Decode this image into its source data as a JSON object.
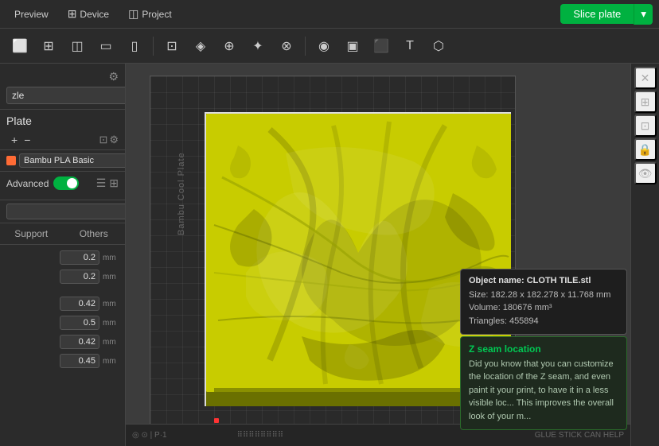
{
  "topbar": {
    "preview_label": "Preview",
    "device_label": "Device",
    "project_label": "Project",
    "slice_label": "Slice plate"
  },
  "toolbar": {
    "tools": [
      "⬜",
      "⊞",
      "◫",
      "▭",
      "▯",
      "⊡",
      "◈",
      "⊕",
      "✦",
      "⊗",
      "◉",
      "▣",
      "⬛",
      "T",
      "⬡"
    ]
  },
  "sidebar": {
    "nozzle_value": "zle",
    "plate_label": "Plate",
    "volumes_label": "",
    "filament_name": "Bambu PLA Basic",
    "advanced_label": "Advanced",
    "tab_support": "Support",
    "tab_others": "Others",
    "settings": [
      {
        "label": "",
        "value": "0.2",
        "unit": "mm"
      },
      {
        "label": "",
        "value": "0.2",
        "unit": "mm"
      },
      {
        "label": "",
        "value": "0.42",
        "unit": "mm"
      },
      {
        "label": "",
        "value": "0.5",
        "unit": "mm"
      },
      {
        "label": "",
        "value": "0.42",
        "unit": "mm"
      },
      {
        "label": "",
        "value": "0.45",
        "unit": "mm"
      }
    ]
  },
  "info_popup": {
    "title": "Object name: CLOTH TILE.stl",
    "line1": "Size: 182.28 x 182.278 x 11.768 mm",
    "line2": "Volume: 180676 mm³",
    "line3": "Triangles: 455894"
  },
  "zseam_popup": {
    "title": "Z seam location",
    "body": "Did you know that you can customize the location of the Z seam, and even paint it your print, to have it in a less visible loc... This improves the overall look of your m..."
  },
  "plate_text": "Bambu Cool Plate",
  "bottom_bar": {
    "text1": "◎ ⊙ | P·1"
  }
}
